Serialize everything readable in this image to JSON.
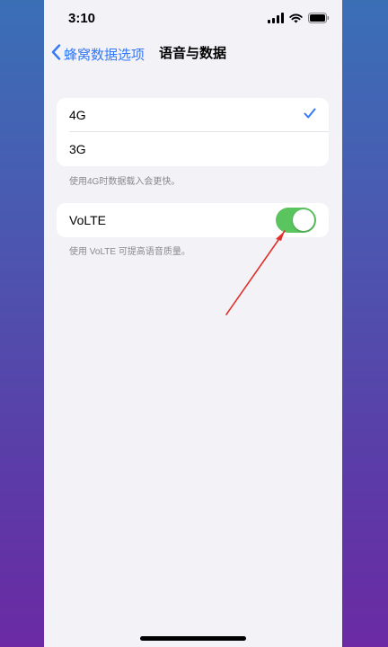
{
  "status_bar": {
    "time": "3:10",
    "icons": [
      "signal-icon",
      "wifi-icon",
      "battery-icon"
    ]
  },
  "nav": {
    "back_label": "蜂窝数据选项",
    "title": "语音与数据"
  },
  "network_options": {
    "items": [
      {
        "label": "4G",
        "selected": true
      },
      {
        "label": "3G",
        "selected": false
      }
    ],
    "footnote": "使用4G时数据载入会更快。"
  },
  "volte": {
    "label": "VoLTE",
    "enabled": true,
    "footnote": "使用 VoLTE 可提高语音质量。"
  },
  "colors": {
    "accent": "#3478f6",
    "toggle_on": "#5ac45e",
    "annotation_arrow": "#e0302a",
    "background": "#f2f2f7"
  }
}
